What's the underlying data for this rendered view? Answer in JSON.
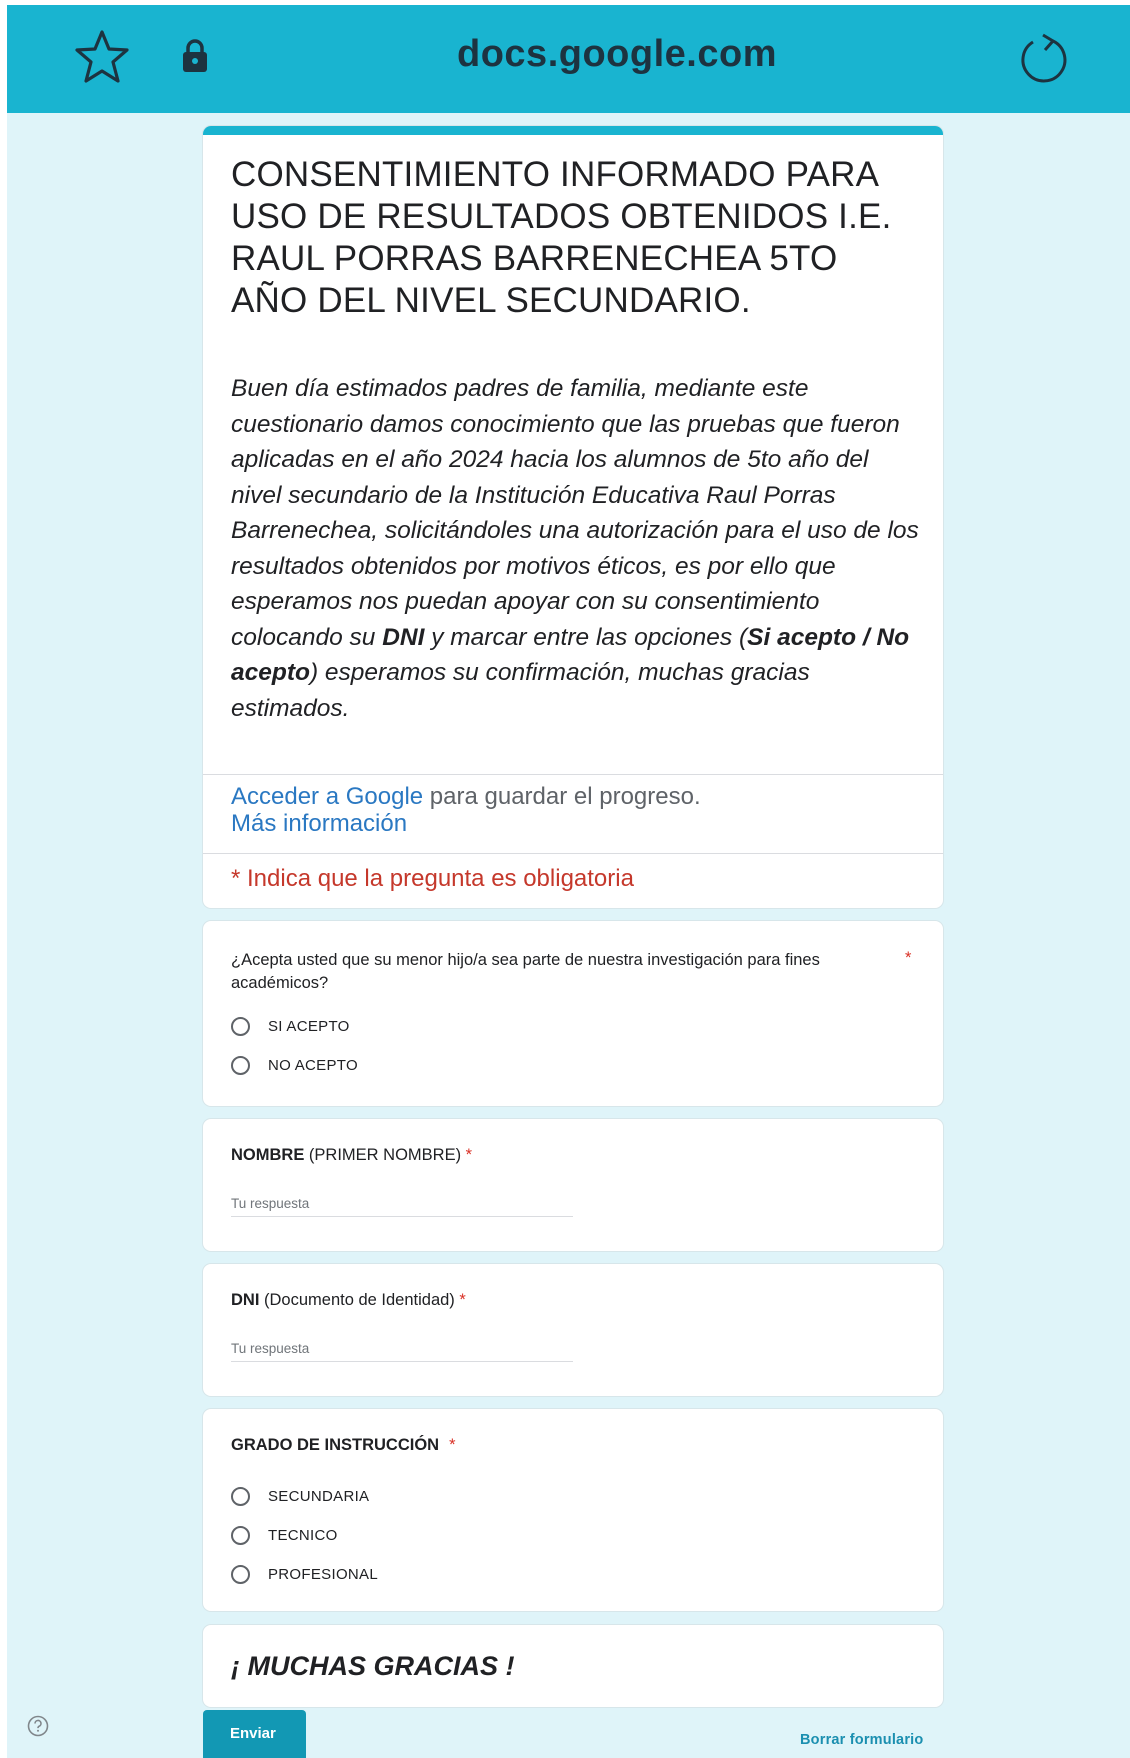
{
  "browser": {
    "url": "docs.google.com",
    "icons": [
      "star-icon",
      "lock-icon",
      "reload-icon"
    ],
    "bar_color": "#19b4d0"
  },
  "form": {
    "title": "CONSENTIMIENTO INFORMADO PARA USO DE RESULTADOS OBTENIDOS I.E. RAUL PORRAS BARRENECHEA 5TO AÑO DEL NIVEL SECUNDARIO.",
    "description": {
      "part1": "Buen día estimados padres de familia, mediante este cuestionario damos conocimiento que las pruebas que fueron aplicadas en el año 2024 hacia los alumnos de 5to año del nivel secundario de la Institución Educativa Raul Porras Barrenechea, solicitándoles una autorización para el uso de los resultados obtenidos por motivos éticos, es por ello que esperamos nos puedan apoyar con su consentimiento colocando su ",
      "bold1": "DNI",
      "part2": " y marcar entre las opciones (",
      "bold2": "Si acepto / No acepto",
      "part3": ") esperamos su confirmación, muchas gracias estimados."
    },
    "signin_link": "Acceder a Google",
    "signin_suffix": " para guardar el progreso.",
    "more_info_link": "Más información",
    "required_note": "* Indica que la pregunta es obligatoria"
  },
  "questions": {
    "consent": {
      "text": "¿Acepta usted que su menor hijo/a sea parte de nuestra investigación para fines académicos?",
      "required_mark": "*",
      "options": [
        "SI ACEPTO",
        "NO ACEPTO"
      ]
    },
    "name": {
      "label_bold": "NOMBRE",
      "label_rest": " (PRIMER NOMBRE)",
      "required_mark": " *",
      "placeholder": "Tu respuesta"
    },
    "dni": {
      "label_bold": "DNI",
      "label_rest": " (Documento de Identidad)",
      "required_mark": " *",
      "placeholder": "Tu respuesta"
    },
    "grade": {
      "label_bold": "GRADO DE INSTRUCCIÓN",
      "required_mark": "*",
      "options": [
        "SECUNDARIA",
        "TECNICO",
        "PROFESIONAL"
      ]
    }
  },
  "thanks": "¡ MUCHAS GRACIAS !",
  "actions": {
    "submit": "Enviar",
    "clear": "Borrar formulario",
    "help_icon": "help-icon"
  },
  "colors": {
    "accent": "#19b4d0",
    "background": "#dff4f9",
    "required": "#d93025",
    "link": "#2a78c2",
    "submit": "#1298b4"
  }
}
